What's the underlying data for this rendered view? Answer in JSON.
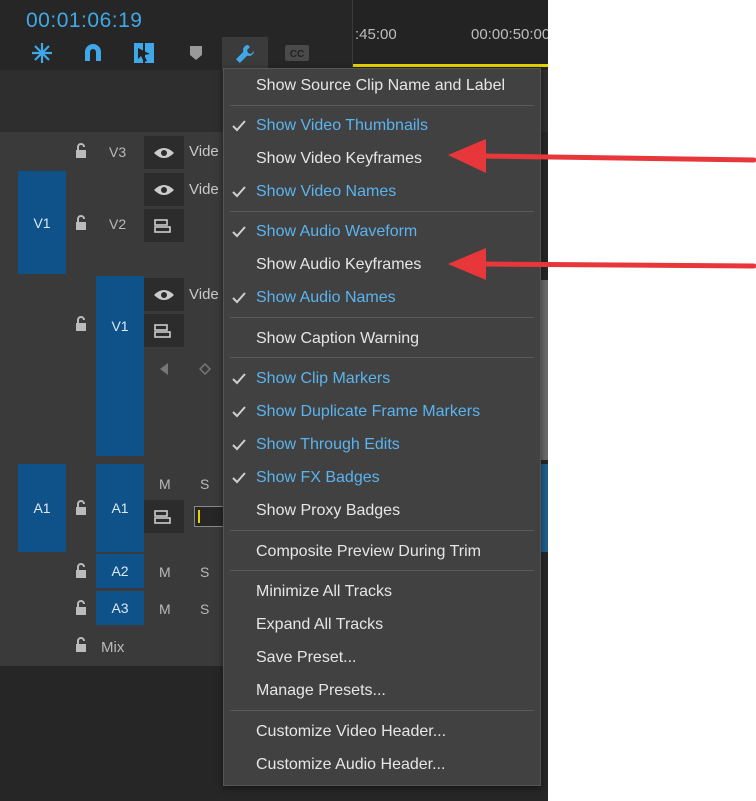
{
  "timecode": "00:01:06:19",
  "ruler": {
    "label_left": ":45:00",
    "label_right": "00:00:50:00"
  },
  "tracks": {
    "v3": "V3",
    "v2": "V2",
    "v1_source": "V1",
    "v1": "V1",
    "a1_source": "A1",
    "a1": "A1",
    "a2": "A2",
    "a3": "A3",
    "mix": "Mix",
    "video_name_partial": "Vide",
    "mute": "M",
    "solo": "S"
  },
  "menu": {
    "items": [
      {
        "label": "Show Source Clip Name and Label",
        "checked": false
      },
      {
        "label": "Show Video Thumbnails",
        "checked": true
      },
      {
        "label": "Show Video Keyframes",
        "checked": false
      },
      {
        "label": "Show Video Names",
        "checked": true
      },
      {
        "label": "Show Audio Waveform",
        "checked": true
      },
      {
        "label": "Show Audio Keyframes",
        "checked": false
      },
      {
        "label": "Show Audio Names",
        "checked": true
      },
      {
        "label": "Show Caption Warning",
        "checked": false
      },
      {
        "label": "Show Clip Markers",
        "checked": true
      },
      {
        "label": "Show Duplicate Frame Markers",
        "checked": true
      },
      {
        "label": "Show Through Edits",
        "checked": true
      },
      {
        "label": "Show FX Badges",
        "checked": true
      },
      {
        "label": "Show Proxy Badges",
        "checked": false
      },
      {
        "label": "Composite Preview During Trim",
        "checked": false
      },
      {
        "label": "Minimize All Tracks",
        "checked": false
      },
      {
        "label": "Expand All Tracks",
        "checked": false
      },
      {
        "label": "Save Preset...",
        "checked": false
      },
      {
        "label": "Manage Presets...",
        "checked": false
      },
      {
        "label": "Customize Video Header...",
        "checked": false
      },
      {
        "label": "Customize Audio Header...",
        "checked": false
      }
    ]
  },
  "colors": {
    "accent": "#3fa9e8",
    "checked_text": "#5ab4ef",
    "track_blue": "#0f5289",
    "arrow": "#e8373a",
    "playhead_bar": "#e6d200"
  }
}
